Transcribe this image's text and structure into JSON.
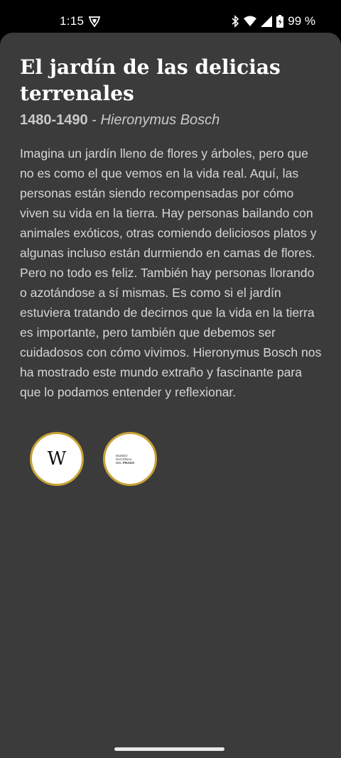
{
  "status_bar": {
    "time": "1:15",
    "battery_percent": "99 %",
    "icons": [
      "shield-icon",
      "bluetooth-icon",
      "wifi-icon",
      "cell-signal-icon",
      "battery-icon"
    ]
  },
  "artwork": {
    "title": "El jardín de las delicias terrenales",
    "years": "1480-1490",
    "separator": " - ",
    "artist": "Hieronymus Bosch",
    "description": "Imagina un jardín lleno de flores y árboles, pero que no es como el que vemos en la vida real. Aquí, las personas están siendo recompensadas por cómo viven su vida en la tierra. Hay personas bailando con animales exóticos, otras comiendo deliciosos platos y algunas incluso están durmiendo en camas de flores. Pero no todo es feliz. También hay personas llorando o azotándose a sí mismas. Es como si el jardín estuviera tratando de decirnos que la vida en la tierra es importante, pero también que debemos ser cuidadosos con cómo vivimos. Hieronymus Bosch nos ha mostrado este mundo extraño y fascinante para que lo podamos entender y reflexionar."
  },
  "links": {
    "wikipedia_logo": "W",
    "prado_logo_line1": "MUSEO NACIONAL",
    "prado_logo_line2_prefix": "DEL ",
    "prado_logo_line2_strong": "PRADO"
  },
  "colors": {
    "sheet_background": "#3b3b3b",
    "accent_ring": "#c8a236"
  }
}
